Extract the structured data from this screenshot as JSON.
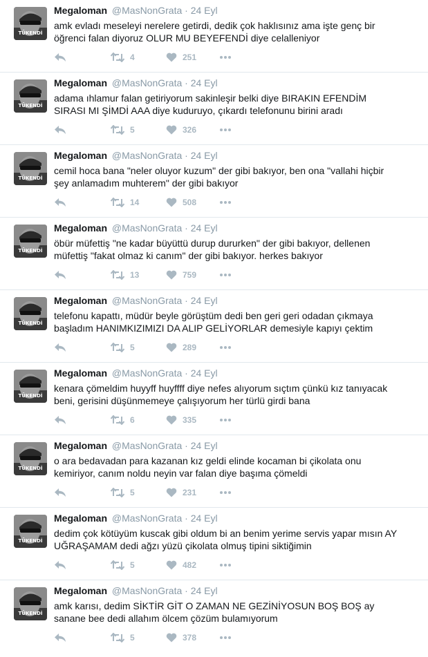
{
  "tweets": [
    {
      "name": "Megaloman",
      "handle": "@MasNonGrata",
      "time": "24 Eyl",
      "text": "amk evladı meseleyi nerelere getirdi, dedik çok haklısınız ama işte genç bir öğrenci falan diyoruz OLUR MU BEYEFENDİ diye celalleniyor",
      "retweets": "4",
      "likes": "251"
    },
    {
      "name": "Megaloman",
      "handle": "@MasNonGrata",
      "time": "24 Eyl",
      "text": "adama ıhlamur falan getiriyorum sakinleşir belki diye BIRAKIN EFENDİM SIRASI MI ŞİMDİ AAA diye kuduruyo, çıkardı telefonunu birini aradı",
      "retweets": "5",
      "likes": "326"
    },
    {
      "name": "Megaloman",
      "handle": "@MasNonGrata",
      "time": "24 Eyl",
      "text": "cemil hoca bana \"neler oluyor kuzum\" der gibi bakıyor, ben ona \"vallahi hiçbir şey anlamadım muhterem\" der gibi bakıyor",
      "retweets": "14",
      "likes": "508"
    },
    {
      "name": "Megaloman",
      "handle": "@MasNonGrata",
      "time": "24 Eyl",
      "text": "öbür müfettiş \"ne kadar büyüttü durup dururken\" der gibi bakıyor, dellenen müfettiş \"fakat olmaz ki canım\" der gibi bakıyor. herkes bakıyor",
      "retweets": "13",
      "likes": "759"
    },
    {
      "name": "Megaloman",
      "handle": "@MasNonGrata",
      "time": "24 Eyl",
      "text": "telefonu kapattı, müdür beyle görüştüm dedi ben geri geri odadan çıkmaya başladım HANIMKIZIMIZI DA ALIP GELİYORLAR demesiyle kapıyı çektim",
      "retweets": "5",
      "likes": "289"
    },
    {
      "name": "Megaloman",
      "handle": "@MasNonGrata",
      "time": "24 Eyl",
      "text": "kenara çömeldim huyyff huyffff diye nefes alıyorum sıçtım çünkü kız tanıyacak beni, gerisini düşünmemeye çalışıyorum her türlü girdi bana",
      "retweets": "6",
      "likes": "335"
    },
    {
      "name": "Megaloman",
      "handle": "@MasNonGrata",
      "time": "24 Eyl",
      "text": "o ara bedavadan para kazanan kız geldi elinde kocaman bi çikolata onu kemiriyor, canım noldu neyin var falan diye başıma çömeldi",
      "retweets": "5",
      "likes": "231"
    },
    {
      "name": "Megaloman",
      "handle": "@MasNonGrata",
      "time": "24 Eyl",
      "text": "dedim çok kötüyüm kuscak gibi oldum bi an benim yerime servis yapar mısın AY UĞRAŞAMAM dedi ağzı yüzü çikolata olmuş tipini siktiğimin",
      "retweets": "5",
      "likes": "482"
    },
    {
      "name": "Megaloman",
      "handle": "@MasNonGrata",
      "time": "24 Eyl",
      "text": "amk karısı, dedim SİKTİR GİT O ZAMAN NE GEZİNİYOSUN BOŞ BOŞ ay sanane bee dedi allahım ölcem çözüm bulamıyorum",
      "retweets": "5",
      "likes": "378"
    }
  ],
  "separator": "·",
  "avatar_caption": "TÜKENDİ",
  "icons": {
    "reply": "reply-icon",
    "retweet": "retweet-icon",
    "like": "heart-icon",
    "more": "more-icon"
  },
  "colors": {
    "name": "#14171a",
    "meta": "#8899a6",
    "action": "#aab8c2",
    "divider": "#e1e8ed"
  }
}
